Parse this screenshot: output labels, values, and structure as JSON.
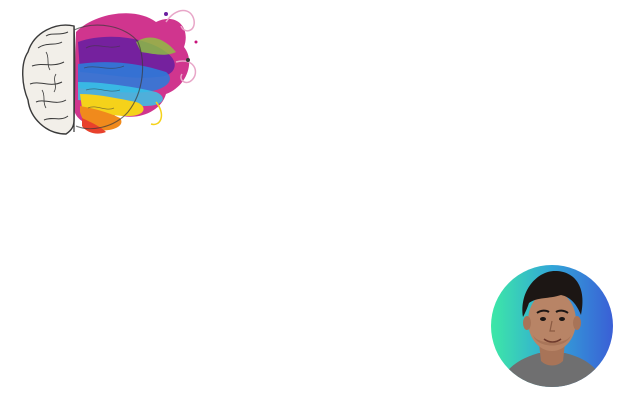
{
  "logo": {
    "icon": "colorful-brain-icon",
    "colors": {
      "left_hemisphere": "#f2efe9",
      "outline": "#3a3a3a",
      "magenta": "#c8127a",
      "purple": "#6a1fa0",
      "blue": "#2f7ad8",
      "cyan": "#38c4e8",
      "green": "#8cc63f",
      "yellow": "#f5d21a",
      "orange": "#f08a1c",
      "red": "#e8412c",
      "pink_swirl": "#e8a6c8"
    }
  },
  "avatar": {
    "icon": "user-avatar",
    "colors": {
      "gradient_start": "#3de8a6",
      "gradient_end": "#3a5fd6",
      "hair": "#1c1614",
      "skin": "#b88466",
      "shirt": "#6f6f70"
    }
  }
}
